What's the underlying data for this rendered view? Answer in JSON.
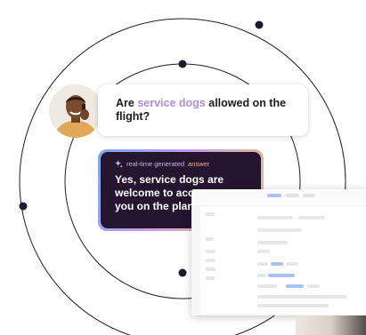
{
  "question": {
    "prefix": "Are ",
    "highlight": "service dogs",
    "suffix": " allowed on the flight?"
  },
  "answer": {
    "tag_prefix": "real-time generated ",
    "tag_highlight": "answer",
    "text": "Yes, service dogs are welcome to accompany you on the plane..."
  },
  "icons": {
    "sparkle": "sparkle-icon",
    "avatar": "person-on-phone-avatar"
  },
  "colors": {
    "question_highlight": "#b58be0",
    "answer_background": "#26152f",
    "answer_tag_highlight": "#f0b27a",
    "orbit_line": "#1c1c2e"
  }
}
